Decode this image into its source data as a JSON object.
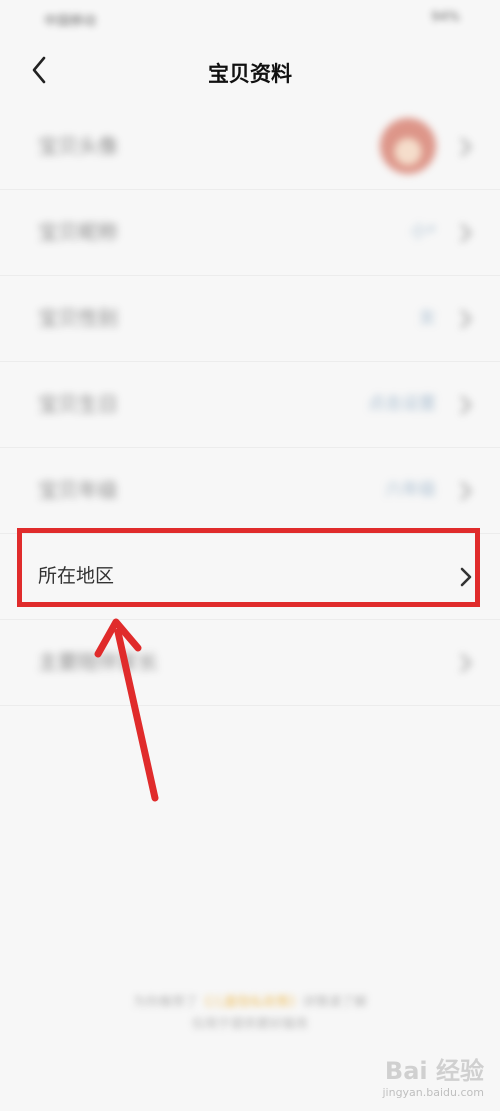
{
  "status_bar": {
    "carrier": "中国移动",
    "right": "94%"
  },
  "header": {
    "title": "宝贝资料"
  },
  "rows": [
    {
      "label": "宝贝头像",
      "value": ""
    },
    {
      "label": "宝贝昵称",
      "value": "小*"
    },
    {
      "label": "宝贝性别",
      "value": "女"
    },
    {
      "label": "宝贝生日",
      "value": "点击设置"
    },
    {
      "label": "宝贝年级",
      "value": "六年级"
    },
    {
      "label": "所在地区",
      "value": ""
    },
    {
      "label": "主要陪伴家长",
      "value": ""
    }
  ],
  "footer": {
    "line1_pre": "为你推荐了",
    "line1_highlight": "《儿童隐私政策》",
    "line1_post": "详情请了解",
    "line2": "仅用于提供更好服务"
  },
  "watermark": {
    "main": "Bai 经验",
    "sub": "jingyan.baidu.com"
  },
  "colors": {
    "highlight_box": "#e02b2b",
    "value_text": "#6a8fb0"
  }
}
